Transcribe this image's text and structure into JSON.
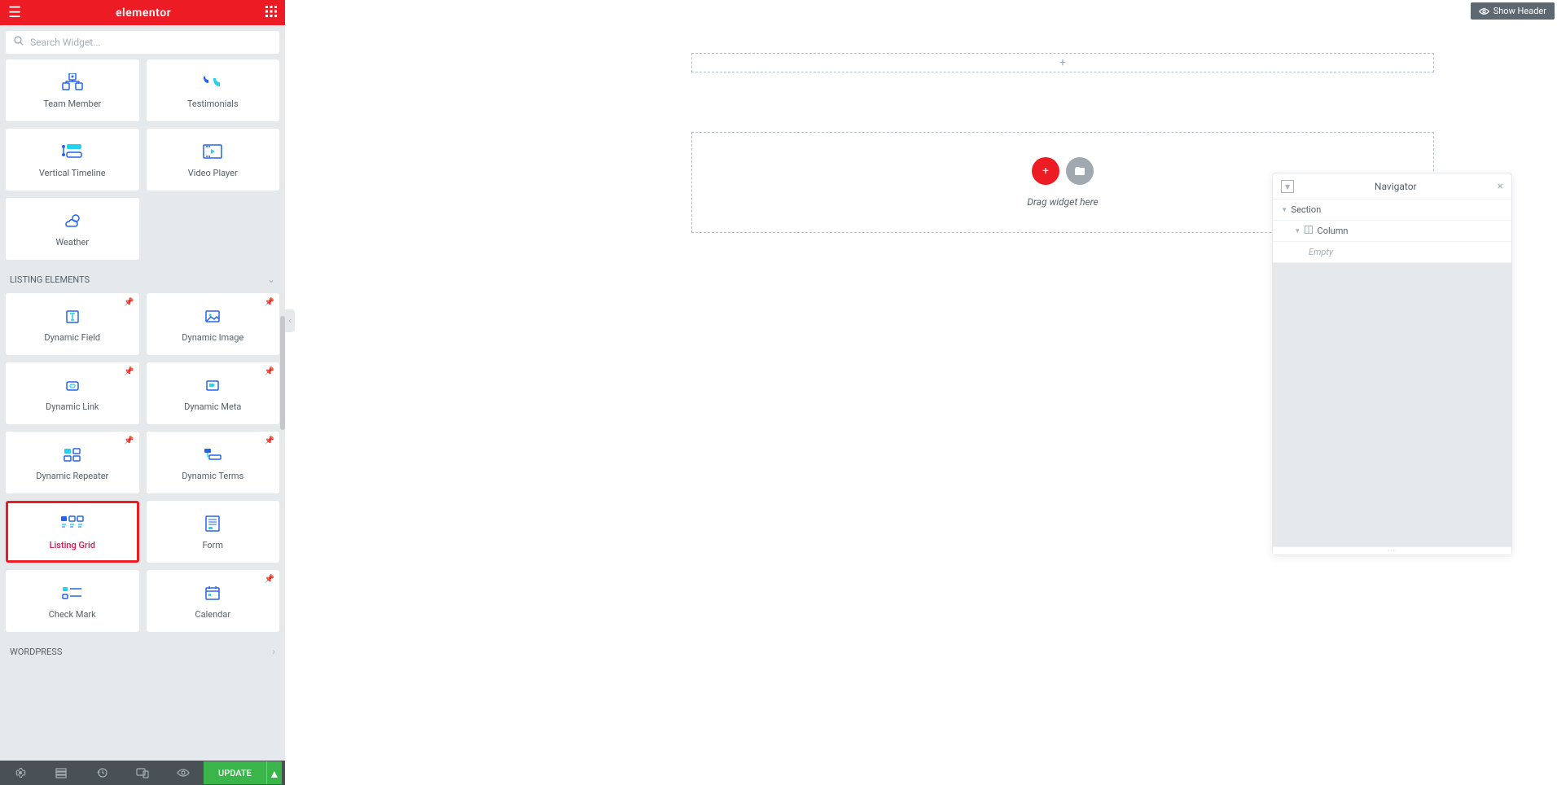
{
  "header": {
    "logo": "elementor"
  },
  "search": {
    "placeholder": "Search Widget..."
  },
  "widgets_top": [
    {
      "label": "Team Member",
      "icon": "team-member"
    },
    {
      "label": "Testimonials",
      "icon": "testimonials"
    },
    {
      "label": "Vertical Timeline",
      "icon": "vertical-timeline"
    },
    {
      "label": "Video Player",
      "icon": "video-player"
    },
    {
      "label": "Weather",
      "icon": "weather"
    }
  ],
  "sections": {
    "listing": {
      "title": "LISTING ELEMENTS"
    },
    "wordpress": {
      "title": "WORDPRESS"
    }
  },
  "widgets_listing": [
    {
      "label": "Dynamic Field",
      "icon": "dynamic-field"
    },
    {
      "label": "Dynamic Image",
      "icon": "dynamic-image"
    },
    {
      "label": "Dynamic Link",
      "icon": "dynamic-link"
    },
    {
      "label": "Dynamic Meta",
      "icon": "dynamic-meta"
    },
    {
      "label": "Dynamic Repeater",
      "icon": "dynamic-repeater"
    },
    {
      "label": "Dynamic Terms",
      "icon": "dynamic-terms"
    },
    {
      "label": "Listing Grid",
      "icon": "listing-grid",
      "highlighted": true
    },
    {
      "label": "Form",
      "icon": "form"
    },
    {
      "label": "Check Mark",
      "icon": "check-mark"
    },
    {
      "label": "Calendar",
      "icon": "calendar"
    }
  ],
  "footer": {
    "update": "UPDATE"
  },
  "canvas": {
    "show_header": "Show Header",
    "drop_text": "Drag widget here"
  },
  "navigator": {
    "title": "Navigator",
    "items": {
      "section": "Section",
      "column": "Column",
      "empty": "Empty"
    }
  }
}
